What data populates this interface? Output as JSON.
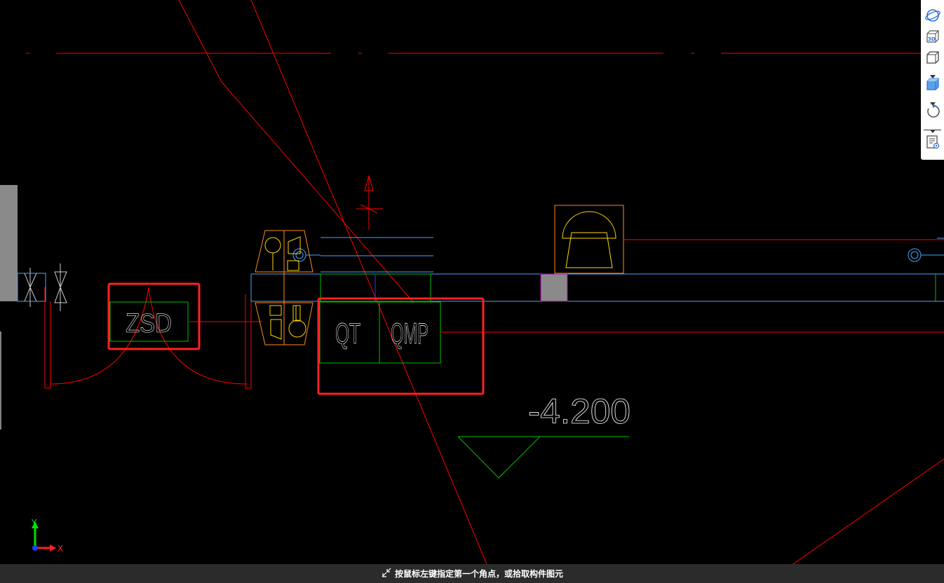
{
  "drawing": {
    "labels": {
      "zsd": "ZSD",
      "qt": "QT",
      "qmp": "QMP",
      "elevation": "-4.200"
    },
    "colors": {
      "background": "#000000",
      "line_red": "#ff0000",
      "line_cyan": "#4aa3ff",
      "line_green": "#00c000",
      "equipment_orange": "#ff8c1a",
      "symbol_yellow": "#ffd700",
      "highlight_red": "#ff2020",
      "text_white": "#ffffff"
    }
  },
  "axis": {
    "x_label": "X",
    "y_label": "Y"
  },
  "toolbar": {
    "icons": [
      "orbit-icon",
      "3d-view-icon",
      "cube-view-icon",
      "shaded-cube-icon",
      "rotate-icon",
      "layer-properties-icon"
    ]
  },
  "status": {
    "message": "按鼠标左键指定第一个角点，或拾取构件图元"
  }
}
